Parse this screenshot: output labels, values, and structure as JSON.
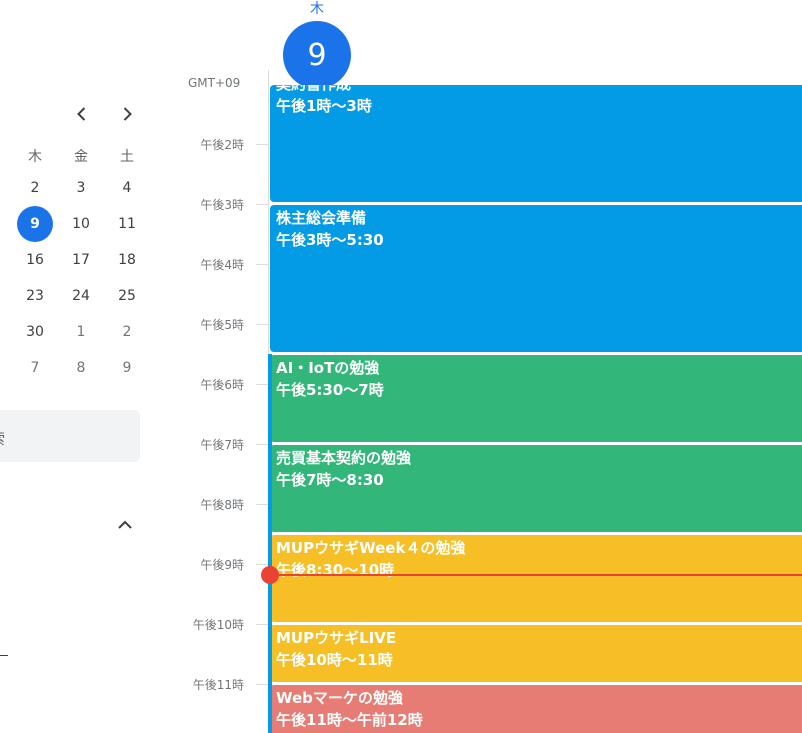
{
  "day_header": {
    "weekday": "木",
    "date": "9",
    "timezone": "GMT+09"
  },
  "mini_calendar": {
    "weekdays": [
      "木",
      "金",
      "土"
    ],
    "weeks": [
      [
        {
          "n": "2"
        },
        {
          "n": "3"
        },
        {
          "n": "4"
        }
      ],
      [
        {
          "n": "9",
          "today": true
        },
        {
          "n": "10"
        },
        {
          "n": "11"
        }
      ],
      [
        {
          "n": "16"
        },
        {
          "n": "17"
        },
        {
          "n": "18"
        }
      ],
      [
        {
          "n": "23"
        },
        {
          "n": "24"
        },
        {
          "n": "25"
        }
      ],
      [
        {
          "n": "30"
        },
        {
          "n": "1",
          "other": true
        },
        {
          "n": "2",
          "other": true
        }
      ],
      [
        {
          "n": "7",
          "other": true
        },
        {
          "n": "8",
          "other": true
        },
        {
          "n": "9",
          "other": true
        }
      ]
    ]
  },
  "search_partial_text": "索",
  "hour_labels": [
    "午後2時",
    "午後3時",
    "午後4時",
    "午後5時",
    "午後6時",
    "午後7時",
    "午後8時",
    "午後9時",
    "午後10時",
    "午後11時"
  ],
  "events": [
    {
      "title": "契約書作成",
      "time": "午後1時〜3時",
      "color": "#039be5"
    },
    {
      "title": "株主総会準備",
      "time": "午後3時〜5:30",
      "color": "#039be5"
    },
    {
      "title": "AI・IoTの勉強",
      "time": "午後5:30〜7時",
      "color": "#33b679"
    },
    {
      "title": "売買基本契約の勉強",
      "time": "午後7時〜8:30",
      "color": "#33b679"
    },
    {
      "title": "MUPウサギWeek４の勉強",
      "time": "午後8:30〜10時",
      "color": "#f6bf26"
    },
    {
      "title": "MUPウサギLIVE",
      "time": "午後10時〜11時",
      "color": "#f6bf26"
    },
    {
      "title": "Webマーケの勉強",
      "time": "午後11時〜午前12時",
      "color": "#e67c73"
    }
  ],
  "colors": {
    "accent": "#1a73e8",
    "now_indicator": "#ea4335"
  },
  "icons": {
    "prev": "chevron-left-icon",
    "next": "chevron-right-icon",
    "collapse": "chevron-up-icon"
  }
}
